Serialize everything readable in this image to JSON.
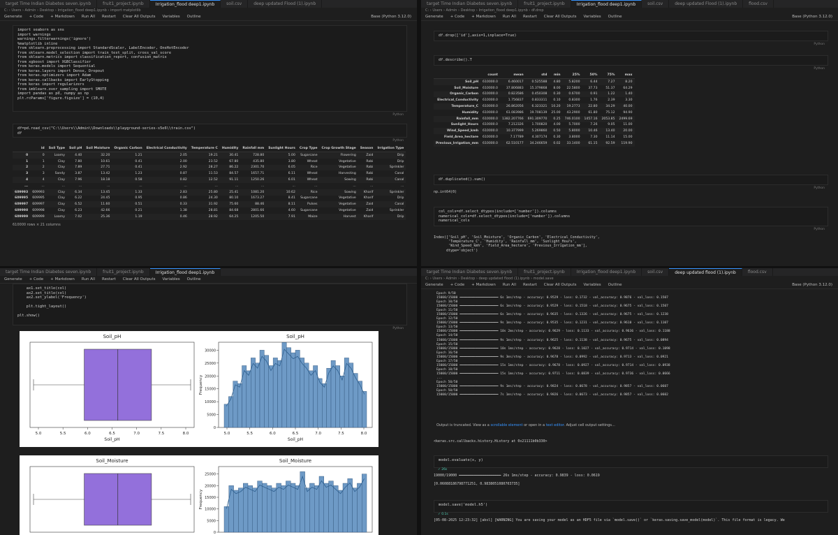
{
  "theme": {
    "accent": "#3794ff",
    "bar_color": "#6e9ac6",
    "box_color": "#9370db"
  },
  "p1": {
    "tabs": [
      "target Time Indian Diabetes seven.ipynb",
      "fruit1_project.ipynb",
      "Irrigation_flood deep1.ipynb",
      "soil.csv",
      "deep updated Flood (1).ipynb"
    ],
    "crumbs": "C: › Users › Admin › Desktop › Irrigation_flood deep1.ipynb › import matplotlib",
    "toolbar": [
      "Generate",
      "+ Code",
      "+ Markdown",
      "Run All",
      "Restart",
      "Clear All Outputs",
      "Variables",
      "Outline"
    ],
    "kernel": "Base (Python 3.12.0)",
    "cell1": "import seaborn as sns\nimport warnings\nwarnings.filterwarnings('ignore')\n%matplotlib inline\nfrom sklearn.preprocessing import StandardScaler, LabelEncoder, OneHotEncoder\nfrom sklearn.model_selection import train_test_split, cross_val_score\nfrom sklearn.metrics import classification_report, confusion_matrix\nfrom xgboost import XGBClassifier\nfrom keras.models import Sequential\nfrom keras.layers import Dense, Dropout\nfrom keras.optimizers import Adam\nfrom keras.callbacks import EarlyStopping\nfrom keras import regularizers\nfrom imblearn.over_sampling import SMOTE\nimport pandas as pd, numpy as np\nplt.rcParams['figure.figsize'] = (10,4)",
    "cell2": "df=pd.read_csv(\"C:\\\\Users\\\\Admin\\\\Downloads\\\\playground-series-s5e6\\\\train.csv\")\ndf",
    "lang": "Python",
    "table": {
      "columns": [
        "",
        "id",
        "Soil Type",
        "Soil pH",
        "Soil Moisture",
        "Organic Carbon",
        "Electrical Conductivity",
        "Temperature C",
        "Humidity",
        "Rainfall mm",
        "Sunlight Hours",
        "Crop Type",
        "Crop Growth Stage",
        "Season",
        "Irrigation Type"
      ],
      "rows": [
        [
          "0",
          "0",
          "Loamy",
          "4.40",
          "32.20",
          "1.21",
          "2.05",
          "19.21",
          "30.41",
          "728.80",
          "5.00",
          "Sugarcane",
          "Flowering",
          "Zaid",
          "Drip"
        ],
        [
          "1",
          "1",
          "Clay",
          "7.80",
          "10.61",
          "0.41",
          "2.00",
          "23.52",
          "67.80",
          "435.80",
          "3.80",
          "Wheat",
          "Vegetative",
          "Rabi",
          "Drip"
        ],
        [
          "2",
          "2",
          "Clay",
          "7.89",
          "27.71",
          "0.41",
          "2.92",
          "28.27",
          "86.22",
          "2301.70",
          "6.05",
          "Rice",
          "Vegetative",
          "Rabi",
          "Sprinkler"
        ],
        [
          "3",
          "3",
          "Sandy",
          "3.87",
          "13.42",
          "1.23",
          "0.87",
          "11.53",
          "84.57",
          "1657.71",
          "6.11",
          "Wheat",
          "Harvesting",
          "Rabi",
          "Canal"
        ],
        [
          "4",
          "4",
          "Clay",
          "7.96",
          "18.18",
          "0.58",
          "0.82",
          "12.52",
          "91.11",
          "1250.26",
          "6.01",
          "Wheat",
          "Sowing",
          "Rabi",
          "Canal"
        ],
        [
          "...",
          "...",
          "...",
          "...",
          "...",
          "...",
          "...",
          "...",
          "...",
          "...",
          "...",
          "...",
          "...",
          "...",
          "..."
        ],
        [
          "609993",
          "609993",
          "Clay",
          "6.34",
          "13.45",
          "1.33",
          "2.83",
          "25.80",
          "25.41",
          "1081.20",
          "10.62",
          "Rice",
          "Sowing",
          "Kharif",
          "Sprinkler"
        ],
        [
          "609995",
          "609995",
          "Clay",
          "6.22",
          "24.45",
          "0.95",
          "0.86",
          "24.30",
          "80.10",
          "1673.27",
          "8.41",
          "Sugarcane",
          "Vegetative",
          "Kharif",
          "Drip"
        ],
        [
          "609997",
          "609997",
          "Clay",
          "6.52",
          "11.60",
          "0.51",
          "0.33",
          "31.92",
          "75.60",
          "88.46",
          "8.11",
          "Pulses",
          "Vegetative",
          "Zaid",
          "Canal"
        ],
        [
          "609998",
          "609998",
          "Clay",
          "6.23",
          "42.66",
          "0.21",
          "1.38",
          "28.81",
          "84.68",
          "2801.66",
          "4.60",
          "Sugarcane",
          "Vegetative",
          "Zaid",
          "Sprinkler"
        ],
        [
          "609999",
          "609999",
          "Loamy",
          "7.02",
          "25.36",
          "1.19",
          "0.46",
          "28.92",
          "64.25",
          "1205.50",
          "7.91",
          "Maize",
          "Harvest",
          "Kharif",
          "Drip"
        ]
      ],
      "footer": "610000 rows × 21 columns"
    }
  },
  "p2": {
    "tabs": [
      "target Time Indian Diabetes seven.ipynb",
      "fruit1_project.ipynb",
      "Irrigation_flood deep1.ipynb",
      "soil.csv",
      "deep updated Flood (1).ipynb",
      "flood.csv"
    ],
    "crumbs": "C: › Users › Admin › Desktop › Irrigation_flood deep1.ipynb › df.drop",
    "toolbar": [
      "Generate",
      "+ Code",
      "+ Markdown",
      "Run All",
      "Restart",
      "Clear All Outputs",
      "Variables",
      "Outline"
    ],
    "kernel": "Base (Python 3.12.0)",
    "cell1": "df.drop(['id'],axis=1,inplace=True)",
    "cell2": "df.describe().T",
    "cell3": "df.duplicated().sum()",
    "out3": "np.int64(0)",
    "cell4": "col_cols=df.select_dtypes(include=['number']).columns\nnumerical_cols=df.select_dtypes(include=['number']).columns\nnumerical_cols",
    "out4": "Index(['Soil_pH', 'Soil_Moisture', 'Organic_Carbon', 'Electrical_Conductivity',\n       'Temperature_C', 'Humidity', 'Rainfall_mm', 'Sunlight_Hours',\n       'Wind_Speed_kmh', 'Field_Area_hectare', 'Previous_Irrigation_mm'],\n      dtype='object')",
    "lang": "Python",
    "describe": {
      "columns": [
        "",
        "count",
        "mean",
        "std",
        "min",
        "25%",
        "50%",
        "75%",
        "max"
      ],
      "rows": [
        [
          "Soil_pH",
          "610000.0",
          "6.460017",
          "0.525588",
          "4.80",
          "5.8200",
          "6.44",
          "7.27",
          "8.20"
        ],
        [
          "Soil_Moisture",
          "610000.0",
          "37.806883",
          "15.379868",
          "8.00",
          "22.5800",
          "37.73",
          "51.37",
          "64.29"
        ],
        [
          "Organic_Carbon",
          "610000.0",
          "0.823586",
          "0.450308",
          "0.30",
          "0.6700",
          "0.91",
          "1.22",
          "1.40"
        ],
        [
          "Electrical_Conductivity",
          "610000.0",
          "1.756837",
          "0.833311",
          "0.10",
          "0.8300",
          "1.76",
          "2.39",
          "3.30"
        ],
        [
          "Temperature_C",
          "610000.0",
          "26.862056",
          "6.323321",
          "10.20",
          "19.2773",
          "22.80",
          "34.29",
          "40.00"
        ],
        [
          "Humidity",
          "610000.0",
          "61.083986",
          "19.708139",
          "25.00",
          "43.2900",
          "61.80",
          "75.12",
          "94.90"
        ],
        [
          "Rainfall_mm",
          "610000.0",
          "1382.207766",
          "691.309770",
          "0.25",
          "746.0100",
          "1457.16",
          "2053.85",
          "2499.69"
        ],
        [
          "Sunlight_Hours",
          "610000.0",
          "7.212326",
          "1.700820",
          "4.00",
          "5.7000",
          "7.26",
          "9.05",
          "11.00"
        ],
        [
          "Wind_Speed_kmh",
          "610000.0",
          "10.377999",
          "5.269860",
          "0.50",
          "5.8000",
          "10.46",
          "13.40",
          "20.00"
        ],
        [
          "Field_Area_hectare",
          "610000.0",
          "7.17789",
          "4.307174",
          "0.30",
          "3.8000",
          "7.30",
          "11.14",
          "15.00"
        ],
        [
          "Previous_Irrigation_mm",
          "610000.0",
          "62.510177",
          "34.246659",
          "0.02",
          "33.1400",
          "61.15",
          "92.59",
          "119.90"
        ]
      ]
    }
  },
  "p3": {
    "tabs": [
      "target Time Indian Diabetes seven.ipynb",
      "fruit1_project.ipynb",
      "Irrigation_flood deep1.ipynb"
    ],
    "toolbar": [
      "Generate",
      "+ Code",
      "+ Markdown",
      "Run All",
      "Restart",
      "Clear All Outputs",
      "Variables",
      "Outline"
    ],
    "cell": "    ax1.set_title(col)\n    ax2.set_title(col)\n    ax2.set_ylabel('Frequency')\n\n    plt.tight_layout()\n\nplt.show()",
    "lang": "Python",
    "fig1": {
      "box_title": "Soil_pH",
      "hist_title": "Soil_pH",
      "box_xlabel": "Soil_pH",
      "hist_xlabel": "Soil_pH",
      "hist_ylabel": "Frequency",
      "box_ticks": [
        "5.0",
        "5.5",
        "6.0",
        "6.5",
        "7.0",
        "7.5",
        "8.0"
      ],
      "hist_xticks": [
        "5.0",
        "5.5",
        "6.0",
        "6.5",
        "7.0",
        "7.5",
        "8.0"
      ],
      "hist_yticks": [
        "0",
        "5000",
        "10000",
        "15000",
        "20000",
        "25000",
        "30000"
      ]
    },
    "fig2": {
      "box_title": "Soil_Moisture",
      "hist_title": "Soil_Moisture",
      "hist_ylabel": "Frequency",
      "hist_yticks": [
        "0",
        "5000",
        "10000",
        "15000",
        "20000",
        "25000"
      ]
    }
  },
  "p4": {
    "tabs": [
      "target Time Indian Diabetes seven.ipynb",
      "fruit1_project.ipynb",
      "Irrigation_flood deep1.ipynb",
      "soil.csv",
      "deep updated flood (1).ipynb",
      "flood.csv"
    ],
    "crumbs": "C: › Users › Admin › Desktop › deep updated flood (1).ipynb › model.save",
    "toolbar": [
      "Generate",
      "+ Code",
      "+ Markdown",
      "Run All",
      "Restart",
      "Clear All Outputs",
      "Variables",
      "Outline"
    ],
    "kernel": "Base (Python 3.12.0)",
    "training": [
      "Epoch 9/50",
      "15000/15000 ━━━━━━━━━━━━━━━━━━━━ 6s 1ms/step - accuracy: 0.9529 - loss: 0.1732 - val_accuracy: 0.9876 - val_loss: 0.1507",
      "Epoch 10/50",
      "15000/15000 ━━━━━━━━━━━━━━━━━━━━ 6s 1ms/step - accuracy: 0.9529 - loss: 0.1518 - val_accuracy: 0.9675 - val_loss: 0.1507",
      "Epoch 11/50",
      "15000/15000 ━━━━━━━━━━━━━━━━━━━━ 6s 1ms/step - accuracy: 0.9635 - loss: 0.1326 - val_accuracy: 0.9675 - val_loss: 0.1238",
      "Epoch 12/50",
      "15000/15000 ━━━━━━━━━━━━━━━━━━━━ 9s 1ms/step - accuracy: 0.9535 - loss: 0.1231 - val_accuracy: 0.9610 - val_loss: 0.1107",
      "Epoch 13/50",
      "15000/15000 ━━━━━━━━━━━━━━━━━━━━ 10s 2ms/step - accuracy: 0.9629 - loss: 0.1133 - val_accuracy: 0.9636 - val_loss: 0.1188",
      "Epoch 14/50",
      "15000/15000 ━━━━━━━━━━━━━━━━━━━━ 9s 1ms/step - accuracy: 0.9625 - loss: 0.1138 - val_accuracy: 0.9675 - val_loss: 0.0894",
      "Epoch 15/50",
      "15000/15000 ━━━━━━━━━━━━━━━━━━━━ 10s 1ms/step - accuracy: 0.9628 - loss: 0.1027 - val_accuracy: 0.9714 - val_loss: 0.1098",
      "Epoch 16/50",
      "15000/15000 ━━━━━━━━━━━━━━━━━━━━ 9s 3ms/step - accuracy: 0.9678 - loss: 0.0992 - val_accuracy: 0.9713 - val_loss: 0.0921",
      "Epoch 17/50",
      "15000/15000 ━━━━━━━━━━━━━━━━━━━━ 15s 1ms/step - accuracy: 0.9678 - loss: 0.0927 - val_accuracy: 0.9714 - val_loss: 0.0938",
      "Epoch 18/50",
      "15000/15000 ━━━━━━━━━━━━━━━━━━━━ 15s 1ms/step - accuracy: 0.9711 - loss: 0.0839 - val_accuracy: 0.9736 - val_loss: 0.0666",
      "...",
      "Epoch 50/50",
      "15000/15000 ━━━━━━━━━━━━━━━━━━━━ 9s 1ms/step - accuracy: 0.9824 - loss: 0.0678 - val_accuracy: 0.9857 - val_loss: 0.0607",
      "Epoch 50/50",
      "15000/15000 ━━━━━━━━━━━━━━━━━━━━ 7s 1ms/step - accuracy: 0.9826 - loss: 0.0673 - val_accuracy: 0.9857 - val_loss: 0.0602"
    ],
    "trunc_pre": "Output is truncated. View as a ",
    "trunc_link1": "scrollable element",
    "trunc_mid": " or open in a ",
    "trunc_link2": "text editor",
    "trunc_post": ". Adjust cell output settings...",
    "history": "<keras.src.callbacks.history.History at 0x21111b0b330>",
    "cell_eval": "model.evaluate(x, y)",
    "cell_eval_time": "✓ 26s",
    "eval_out1": "19000/19000 ━━━━━━━━━━━━━━━━━━━━ 26s 1ms/step - accuracy: 0.9839 - loss: 0.0619",
    "eval_out2": "[0.06088186798771251, 0.9838051080703735]",
    "cell_save": "model.save('model.h5')",
    "cell_save_time": "✓ 0.1s",
    "save_out": "[05-08-2025 12:23:32] [absl] [WARNING] You are saving your model as an HDF5 file via `model.save()` or `keras.saving.save_model(model)`. This file format is legacy. We"
  }
}
